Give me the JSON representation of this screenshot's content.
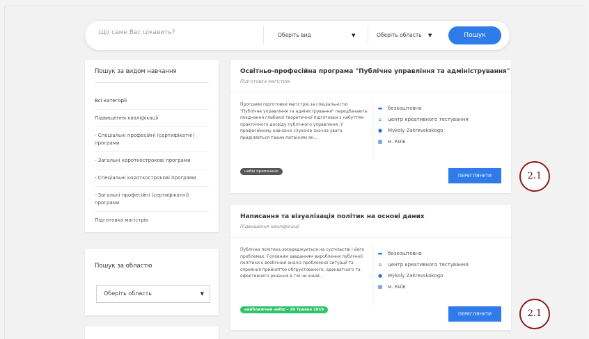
{
  "search": {
    "placeholder": "Що саме Вас цікавить?",
    "type_select": "Оберіть вид",
    "region_select": "Оберіть область",
    "button": "Пошук"
  },
  "sidebar": {
    "by_type_title": "Пошук за видом навчання",
    "items": [
      {
        "label": "Всі категорії"
      },
      {
        "label": "Підвищення кваліфікації"
      },
      {
        "label": "- Спеціальні професійні (сертифікатні) програми"
      },
      {
        "label": "- Загальні короткострокові програми"
      },
      {
        "label": "- Спеціальні короткострокові програми"
      },
      {
        "label": "- Загальні професійні (сертифікатні) програми"
      },
      {
        "label": "Підготовка магістрів"
      }
    ],
    "by_region_title": "Пошук за областю",
    "region_select": "Оберіть область"
  },
  "cards": [
    {
      "title": "Освітньо-професійна програма \"Публічне управління та адміністрування\"",
      "subtitle": "Підготовка магістрів",
      "description": "Програми підготовки магістрів за спеціальністю \"Публічне управління та адміністрування\" передбачають поєднання глибокої теоретичної підготовки з набуттям практичного досвіду публічного управління. У професійному навчанні слухачів значна увага приділяється таким питанням як...",
      "price": "безкоштовно",
      "center": "центр креативного тестування",
      "person": "Mykoly Zakrevskokogo",
      "city": "м. Київ",
      "badge": "набір припинено",
      "button": "ПЕРЕГЛЯНУТИ",
      "annotation": "2.1"
    },
    {
      "title": "Написання та візуалізація політик на основі даних",
      "subtitle": "Підвищення кваліфікації",
      "description": "Публічна політика зосереджується на суспільстві і його проблемах. Головним завданням вироблення публічної політики є всебічний аналіз проблемної ситуації та сприяння прийняттю обґрунтованого, адекватного та ефективного рішення в тій чи іншій...",
      "price": "безкоштовно",
      "center": "центр креативного тестування",
      "person": "Mykoly Zakrevskokogo",
      "city": "м. Київ",
      "badge": "найближчий набір - 20 Травня 2019",
      "button": "ПЕРЕГЛЯНУТИ",
      "annotation": "2.1"
    }
  ],
  "icons": {
    "price": "money-icon",
    "center": "building-icon",
    "person": "location-pin-icon",
    "city": "map-icon"
  },
  "colors": {
    "accent": "#2f7be9",
    "badge_green": "#2cc36b",
    "badge_dark": "#555555",
    "annotation": "#8b1a1a"
  }
}
